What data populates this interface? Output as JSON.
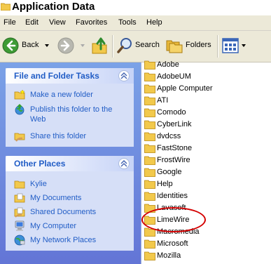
{
  "window": {
    "title": "Application Data"
  },
  "menu": [
    "File",
    "Edit",
    "View",
    "Favorites",
    "Tools",
    "Help"
  ],
  "toolbar": {
    "back": "Back",
    "search": "Search",
    "folders": "Folders"
  },
  "tasks_panel": {
    "title": "File and Folder Tasks",
    "items": [
      {
        "label": "Make a new folder",
        "icon": "new-folder-icon"
      },
      {
        "label": "Publish this folder to the Web",
        "icon": "publish-web-icon"
      },
      {
        "label": "Share this folder",
        "icon": "share-folder-icon"
      }
    ]
  },
  "places_panel": {
    "title": "Other Places",
    "items": [
      {
        "label": "Kylie",
        "icon": "folder-icon"
      },
      {
        "label": "My Documents",
        "icon": "my-documents-icon"
      },
      {
        "label": "Shared Documents",
        "icon": "shared-documents-icon"
      },
      {
        "label": "My Computer",
        "icon": "my-computer-icon"
      },
      {
        "label": "My Network Places",
        "icon": "network-places-icon"
      }
    ]
  },
  "folders": [
    "Adobe",
    "AdobeUM",
    "Apple Computer",
    "ATI",
    "Comodo",
    "CyberLink",
    "dvdcss",
    "FastStone",
    "FrostWire",
    "Google",
    "Help",
    "Identities",
    "Lavasoft",
    "LimeWire",
    "Macromedia",
    "Microsoft",
    "Mozilla"
  ],
  "colors": {
    "highlight": "#d40000",
    "link": "#215dc6",
    "pane": "#6f8fe0"
  }
}
